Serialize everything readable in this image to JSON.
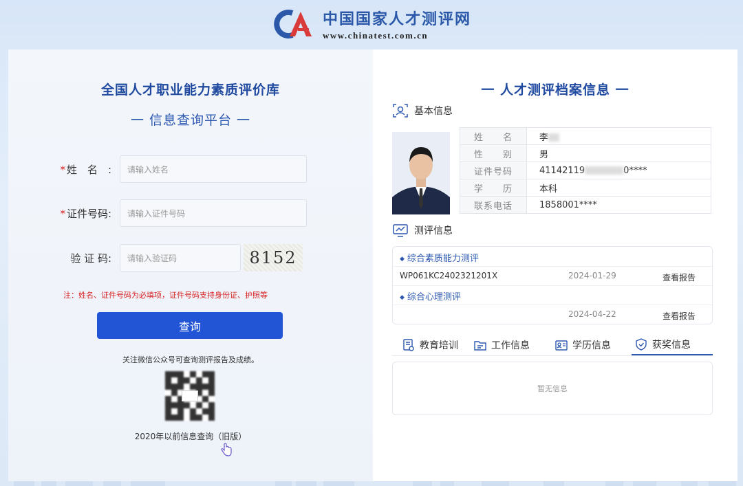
{
  "header": {
    "logo_name": "中国国家人才测评网",
    "logo_url": "www.chinatest.com.cn"
  },
  "query_form": {
    "title": "全国人才职业能力素质评价库",
    "subtitle": "一 信息查询平台 一",
    "name_label": "姓　名　:",
    "name_placeholder": "请输入姓名",
    "id_label": "证件号码:",
    "id_placeholder": "请输入证件号码",
    "captcha_label": "验 证 码:",
    "captcha_placeholder": "请输入验证码",
    "captcha_value": "8152",
    "note": "注：姓名、证件号码为必填项，证件号码支持身份证、护照等",
    "query_button": "查询",
    "follow_text": "关注微信公众号可查询测评报告及成绩。",
    "old_version_link": "2020年以前信息查询（旧版）"
  },
  "archive": {
    "title": "一 人才测评档案信息 一",
    "basic_section": "基本信息",
    "basic_info": [
      {
        "key": "姓　　名",
        "value": "李"
      },
      {
        "key": "性　　别",
        "value": "男"
      },
      {
        "key": "证件号码",
        "value": "41142119",
        "suffix": "0****"
      },
      {
        "key": "学　　历",
        "value": "本科"
      },
      {
        "key": "联系电话",
        "value": "1858001****"
      }
    ],
    "eval_section": "测评信息",
    "evaluations": [
      {
        "category": "综合素质能力测评",
        "code": "WP061KC2402321201X",
        "date": "2024-01-29",
        "link": "查看报告"
      },
      {
        "category": "综合心理测评",
        "code": "",
        "date": "2024-04-22",
        "link": "查看报告"
      }
    ],
    "tabs": [
      {
        "label": "教育培训",
        "icon": "education-doc-icon"
      },
      {
        "label": "工作信息",
        "icon": "work-folder-icon"
      },
      {
        "label": "学历信息",
        "icon": "degree-card-icon"
      },
      {
        "label": "获奖信息",
        "icon": "award-shield-icon",
        "active": true
      }
    ],
    "empty_text": "暂无信息"
  },
  "colors": {
    "brand_blue": "#2255d6",
    "title_blue": "#1f4aa0",
    "required_red": "#d62020"
  }
}
